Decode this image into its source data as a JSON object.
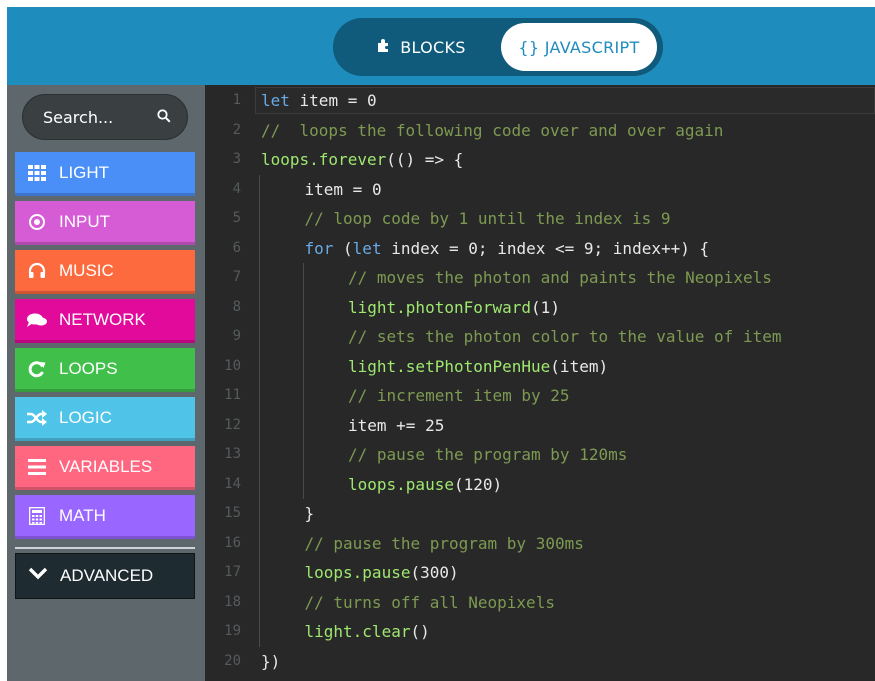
{
  "header": {
    "tabs": [
      {
        "label": "BLOCKS",
        "icon": "puzzle-icon",
        "active": false
      },
      {
        "label": "{} JAVASCRIPT",
        "icon": "braces-icon",
        "active": true
      }
    ]
  },
  "sidebar": {
    "search": {
      "placeholder": "Search...",
      "icon": "search-icon"
    },
    "categories": [
      {
        "label": "LIGHT",
        "color": "#4a8ff7",
        "icon": "grid-icon"
      },
      {
        "label": "INPUT",
        "color": "#d65cd6",
        "icon": "circle-dot-icon"
      },
      {
        "label": "MUSIC",
        "color": "#fd6a3d",
        "icon": "headphones-icon"
      },
      {
        "label": "NETWORK",
        "color": "#e20a9b",
        "icon": "chat-icon"
      },
      {
        "label": "LOOPS",
        "color": "#40bf4a",
        "icon": "refresh-icon"
      },
      {
        "label": "LOGIC",
        "color": "#4fc4e8",
        "icon": "shuffle-icon"
      },
      {
        "label": "VARIABLES",
        "color": "#ff6680",
        "icon": "list-icon"
      },
      {
        "label": "MATH",
        "color": "#9966ff",
        "icon": "calculator-icon"
      }
    ],
    "advanced": {
      "label": "ADVANCED",
      "icon": "chevron-down-icon"
    }
  },
  "editor": {
    "lines": [
      {
        "n": "1",
        "indent": 0,
        "tokens": [
          [
            "kw",
            "let"
          ],
          [
            "id",
            " item = "
          ],
          [
            "num",
            "0"
          ]
        ]
      },
      {
        "n": "2",
        "indent": 0,
        "tokens": [
          [
            "cm",
            "//  loops the following code over and over again"
          ]
        ]
      },
      {
        "n": "3",
        "indent": 0,
        "tokens": [
          [
            "fn",
            "loops.forever"
          ],
          [
            "pl",
            "(() => {"
          ]
        ]
      },
      {
        "n": "4",
        "indent": 1,
        "tokens": [
          [
            "id",
            "item = "
          ],
          [
            "num",
            "0"
          ]
        ]
      },
      {
        "n": "5",
        "indent": 1,
        "tokens": [
          [
            "cm",
            "// loop code by 1 until the index is 9"
          ]
        ]
      },
      {
        "n": "6",
        "indent": 1,
        "tokens": [
          [
            "kw",
            "for"
          ],
          [
            "pl",
            " ("
          ],
          [
            "kw",
            "let"
          ],
          [
            "id",
            " index = "
          ],
          [
            "num",
            "0"
          ],
          [
            "pl",
            "; index <= "
          ],
          [
            "num",
            "9"
          ],
          [
            "pl",
            "; index++) {"
          ]
        ]
      },
      {
        "n": "7",
        "indent": 2,
        "tokens": [
          [
            "cm",
            "// moves the photon and paints the Neopixels"
          ]
        ]
      },
      {
        "n": "8",
        "indent": 2,
        "tokens": [
          [
            "fn",
            "light.photonForward"
          ],
          [
            "pl",
            "("
          ],
          [
            "num",
            "1"
          ],
          [
            "pl",
            ")"
          ]
        ]
      },
      {
        "n": "9",
        "indent": 2,
        "tokens": [
          [
            "cm",
            "// sets the photon color to the value of item"
          ]
        ]
      },
      {
        "n": "10",
        "indent": 2,
        "tokens": [
          [
            "fn",
            "light.setPhotonPenHue"
          ],
          [
            "pl",
            "(item)"
          ]
        ]
      },
      {
        "n": "11",
        "indent": 2,
        "tokens": [
          [
            "cm",
            "// increment item by 25"
          ]
        ]
      },
      {
        "n": "12",
        "indent": 2,
        "tokens": [
          [
            "id",
            "item += "
          ],
          [
            "num",
            "25"
          ]
        ]
      },
      {
        "n": "13",
        "indent": 2,
        "tokens": [
          [
            "cm",
            "// pause the program by 120ms"
          ]
        ]
      },
      {
        "n": "14",
        "indent": 2,
        "tokens": [
          [
            "fn",
            "loops.pause"
          ],
          [
            "pl",
            "("
          ],
          [
            "num",
            "120"
          ],
          [
            "pl",
            ")"
          ]
        ]
      },
      {
        "n": "15",
        "indent": 1,
        "tokens": [
          [
            "pl",
            "}"
          ]
        ]
      },
      {
        "n": "16",
        "indent": 1,
        "tokens": [
          [
            "cm",
            "// pause the program by 300ms"
          ]
        ]
      },
      {
        "n": "17",
        "indent": 1,
        "tokens": [
          [
            "fn",
            "loops.pause"
          ],
          [
            "pl",
            "("
          ],
          [
            "num",
            "300"
          ],
          [
            "pl",
            ")"
          ]
        ]
      },
      {
        "n": "18",
        "indent": 1,
        "tokens": [
          [
            "cm",
            "// turns off all Neopixels"
          ]
        ]
      },
      {
        "n": "19",
        "indent": 1,
        "tokens": [
          [
            "fn",
            "light.clear"
          ],
          [
            "pl",
            "()"
          ]
        ]
      },
      {
        "n": "20",
        "indent": 0,
        "tokens": [
          [
            "pl",
            "})"
          ]
        ]
      }
    ]
  }
}
